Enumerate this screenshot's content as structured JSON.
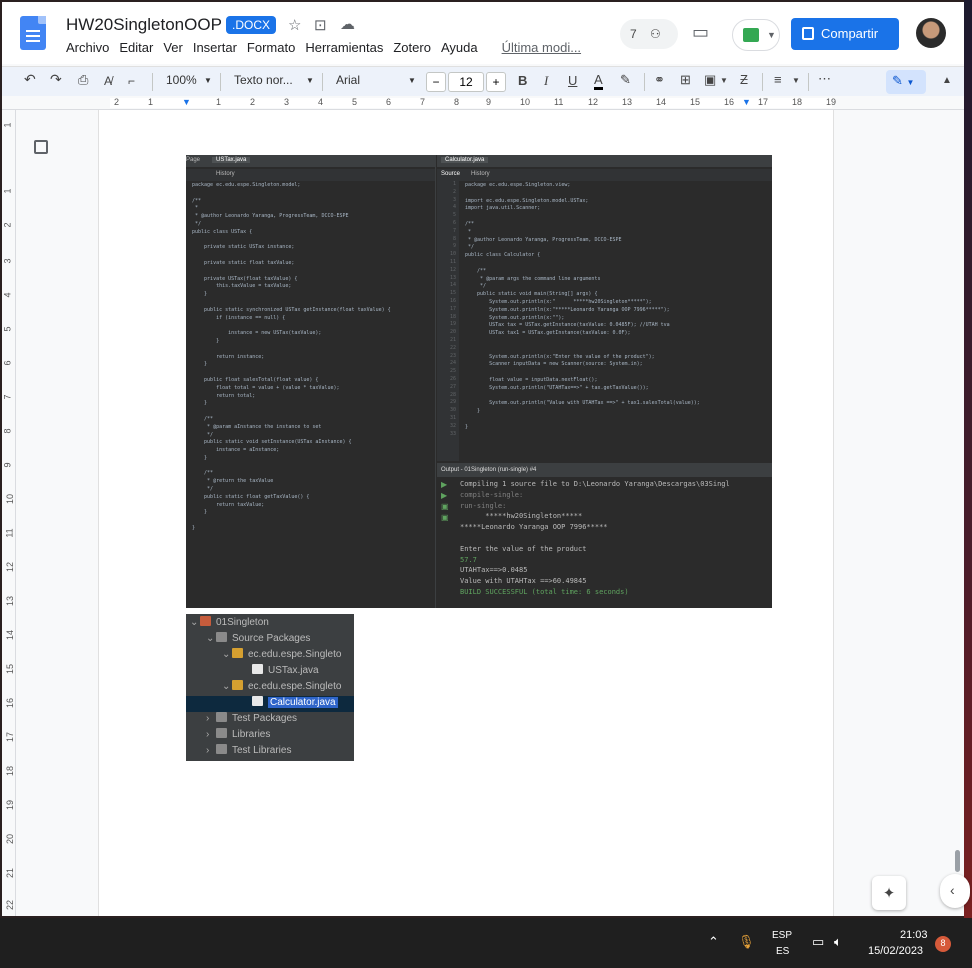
{
  "doc": {
    "title": "HW20SingletonOOP",
    "badge": ".DOCX",
    "menus": [
      "Archivo",
      "Editar",
      "Ver",
      "Insertar",
      "Formato",
      "Herramientas",
      "Zotero",
      "Ayuda"
    ],
    "last_edit": "Última modi...",
    "comments_count": "7",
    "share_label": "Compartir"
  },
  "toolbar": {
    "zoom": "100%",
    "style": "Texto nor...",
    "font": "Arial",
    "font_size": "12",
    "minus": "−",
    "plus": "+",
    "bold": "B",
    "italic": "I",
    "underline": "U",
    "color": "A"
  },
  "ruler_numbers": [
    "2",
    "1",
    "1",
    "2",
    "3",
    "4",
    "5",
    "6",
    "7",
    "8",
    "9",
    "10",
    "11",
    "12",
    "13",
    "14",
    "15",
    "16",
    "17",
    "18",
    "19"
  ],
  "vruler_numbers": [
    "1",
    "1",
    "2",
    "3",
    "4",
    "5",
    "6",
    "7",
    "8",
    "9",
    "10",
    "11",
    "12",
    "13",
    "14",
    "15",
    "16",
    "17",
    "18",
    "19",
    "20",
    "21",
    "22"
  ],
  "ide": {
    "left_tabs": [
      "Page",
      "USTax.java",
      "History"
    ],
    "right_tabs": [
      "Calculator.java",
      "Source",
      "History"
    ],
    "output_tab": "Output - 01Singleton (run-single) #4",
    "left_code": [
      "package ec.edu.espe.Singleton.model;",
      "",
      "/**",
      " *",
      " * @author Leonardo Yaranga, ProgressTeam, DCCO-ESPE",
      " */",
      "public class USTax {",
      "",
      "    private static USTax instance;",
      "",
      "    private static float taxValue;",
      "",
      "    private USTax(float taxValue) {",
      "        this.taxValue = taxValue;",
      "    }",
      "",
      "    public static synchronized USTax getInstance(float taxValue) {",
      "        if (instance == null) {",
      "",
      "            instance = new USTax(taxValue);",
      "        }",
      "",
      "        return instance;",
      "    }",
      "",
      "    public float salesTotal(float value) {",
      "        float total = value + (value * taxValue);",
      "        return total;",
      "    }",
      "",
      "    /**",
      "     * @param aInstance the instance to set",
      "     */",
      "    public static void setInstance(USTax aInstance) {",
      "        instance = aInstance;",
      "    }",
      "",
      "    /**",
      "     * @return the taxValue",
      "     */",
      "    public static float getTaxValue() {",
      "        return taxValue;",
      "    }",
      "",
      "}"
    ],
    "right_code": [
      "package ec.edu.espe.Singleton.view;",
      "",
      "import ec.edu.espe.Singleton.model.USTax;",
      "import java.util.Scanner;",
      "",
      "/**",
      " *",
      " * @author Leonardo Yaranga, ProgressTeam, DCCO-ESPE",
      " */",
      "public class Calculator {",
      "",
      "    /**",
      "     * @param args the command line arguments",
      "     */",
      "    public static void main(String[] args) {",
      "        System.out.println(x:\"      *****hw20Singleton*****\");",
      "        System.out.println(x:\"*****Leonardo Yaranga OOP 7996*****\");",
      "        System.out.println(x:\"\");",
      "        USTax tax = USTax.getInstance(taxValue: 0.0485F); //UTAH tva",
      "        USTax tax1 = USTax.getInstance(taxValue: 0.0F);",
      "",
      "",
      "        System.out.println(x:\"Enter the value of the product\");",
      "        Scanner inputData = new Scanner(source: System.in);",
      "",
      "        float value = inputData.nextFloat();",
      "        System.out.println(\"UTAHTax==>\" + tax.getTaxValue());",
      "",
      "        System.out.println(\"Value with UTAHTax ==>\" + tax1.salesTotal(value));",
      "    }",
      "",
      "}"
    ],
    "right_line_numbers": [
      "1",
      "2",
      "3",
      "4",
      "5",
      "6",
      "7",
      "8",
      "9",
      "10",
      "11",
      "12",
      "13",
      "14",
      "15",
      "16",
      "17",
      "18",
      "19",
      "20",
      "21",
      "22",
      "23",
      "24",
      "25",
      "26",
      "27",
      "28",
      "29",
      "30",
      "31",
      "32",
      "33"
    ],
    "output": [
      "Compiling 1 source file to D:\\Leonardo Yaranga\\Descargas\\03Singl",
      "compile-single:",
      "run-single:",
      "      *****hw20Singleton*****",
      "*****Leonardo Yaranga OOP 7996*****",
      "",
      "Enter the value of the product",
      "57.7",
      "UTAHTax==>0.0485",
      "Value with UTAHTax ==>60.49845",
      "BUILD SUCCESSFUL (total time: 6 seconds)"
    ]
  },
  "tree": {
    "project": "01Singleton",
    "source_packages": "Source Packages",
    "pkg_model": "ec.edu.espe.Singleto",
    "file_ustax": "USTax.java",
    "pkg_view": "ec.edu.espe.Singleto",
    "file_calc": "Calculator.java",
    "test_packages": "Test Packages",
    "libraries": "Libraries",
    "test_libraries": "Test Libraries"
  },
  "taskbar": {
    "lang1": "ESP",
    "lang2": "ES",
    "time": "21:03",
    "date": "15/02/2023",
    "notifications": "8"
  }
}
